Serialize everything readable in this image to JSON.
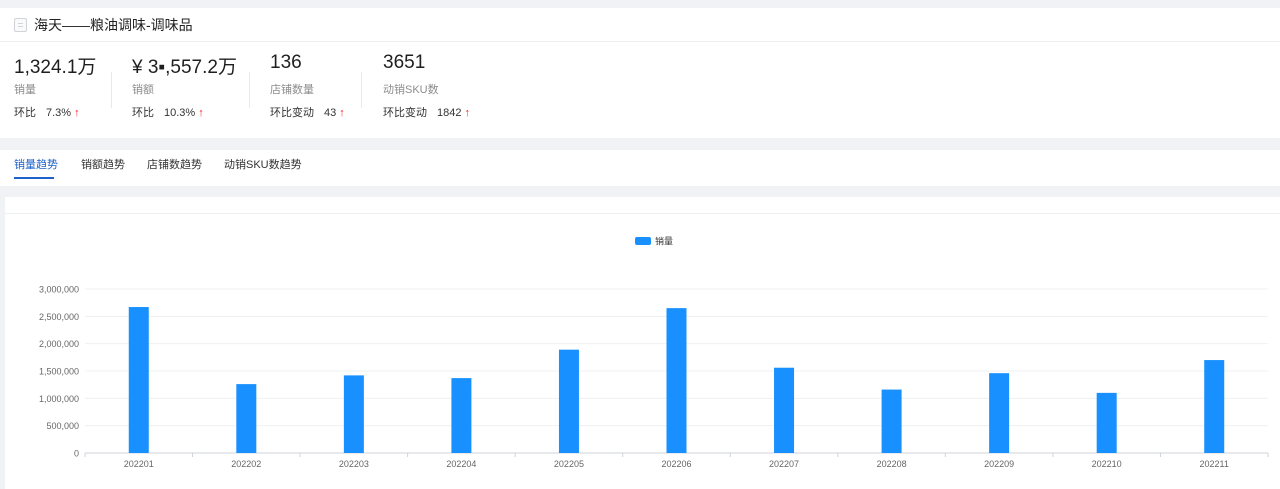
{
  "header": {
    "title": "海天——粮油调味-调味品"
  },
  "stats": [
    {
      "value": "1,324.1万",
      "label": "销量",
      "change_label": "环比",
      "change_value": "7.3%",
      "trend": "up"
    },
    {
      "value": "¥ 3▪,557.2万",
      "label": "销额",
      "change_label": "环比",
      "change_value": "10.3%",
      "trend": "up"
    },
    {
      "value": "136",
      "label": "店铺数量",
      "change_label": "环比变动",
      "change_value": "43",
      "trend": "up"
    },
    {
      "value": "3651",
      "label": "动销SKU数",
      "change_label": "环比变动",
      "change_value": "1842",
      "trend": "up"
    }
  ],
  "tabs": [
    {
      "label": "销量趋势",
      "active": true
    },
    {
      "label": "销额趋势",
      "active": false
    },
    {
      "label": "店铺数趋势",
      "active": false
    },
    {
      "label": "动销SKU数趋势",
      "active": false
    }
  ],
  "colors": {
    "accent": "#1d62c9",
    "bar": "#1890ff",
    "up": "#f5222d"
  },
  "chart_data": {
    "type": "bar",
    "categories": [
      "202201",
      "202202",
      "202203",
      "202204",
      "202205",
      "202206",
      "202207",
      "202208",
      "202209",
      "202210",
      "202211"
    ],
    "series": [
      {
        "name": "销量",
        "values": [
          2670000,
          1260000,
          1420000,
          1370000,
          1890000,
          2650000,
          1560000,
          1160000,
          1460000,
          1100000,
          1700000
        ]
      }
    ],
    "yticks": [
      "0",
      "500,000",
      "1,000,000",
      "1,500,000",
      "2,000,000",
      "2,500,000",
      "3,000,000"
    ],
    "ylim": [
      0,
      3000000
    ],
    "legend_position": "top-center",
    "grid": true,
    "title": "",
    "xlabel": "",
    "ylabel": ""
  }
}
